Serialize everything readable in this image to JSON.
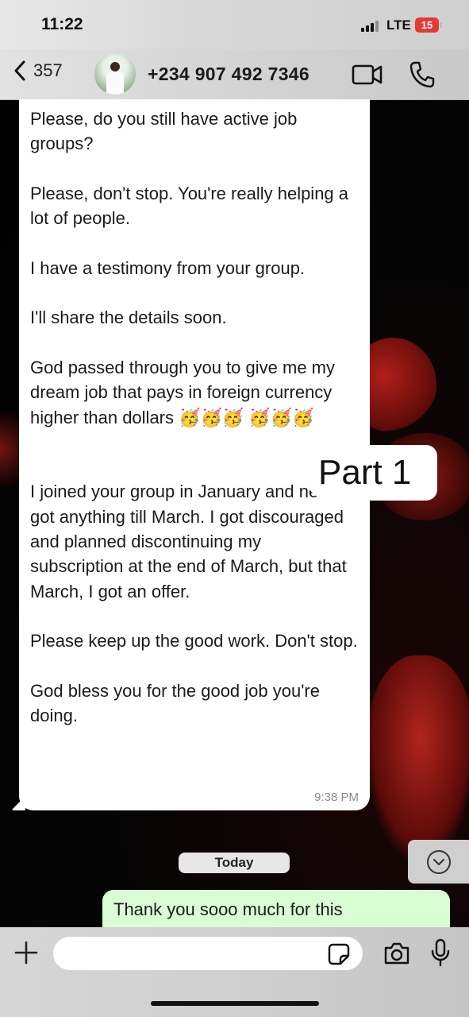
{
  "status_bar": {
    "time": "11:22",
    "network": "LTE",
    "battery": "15"
  },
  "header": {
    "back_count": "357",
    "contact_name": "+234 907 492 7346"
  },
  "incoming_message": {
    "paragraphs": [
      "Please, do you still have active job groups?",
      "Please, don't stop. You're really helping a lot of people.",
      "I have a testimony from your group.",
      "I'll share the details soon.",
      "God passed through you to give me my dream job that pays in foreign currency higher than dollars 🥳🥳🥳 🥳🥳🥳",
      "I joined your group in January and never got anything till March. I got discouraged and planned discontinuing my subscription at the end of March, but that March, I got an offer.",
      "Please keep up the good work. Don't stop.",
      "God bless you for the good job you're doing."
    ],
    "time": "9:38 PM"
  },
  "overlay_label": "Part 1",
  "date_separator": "Today",
  "outgoing_message": {
    "text": "Thank you sooo much for this"
  },
  "composer": {
    "placeholder": ""
  },
  "icons": {
    "back": "chevron-left-icon",
    "video": "video-call-icon",
    "phone": "phone-icon",
    "plus": "plus-icon",
    "sticker": "sticker-icon",
    "camera": "camera-icon",
    "mic": "microphone-icon",
    "scroll": "chevron-down-icon"
  },
  "colors": {
    "outgoing_bubble": "#d9fdd3",
    "incoming_bubble": "#ffffff",
    "battery": "#e53935"
  }
}
